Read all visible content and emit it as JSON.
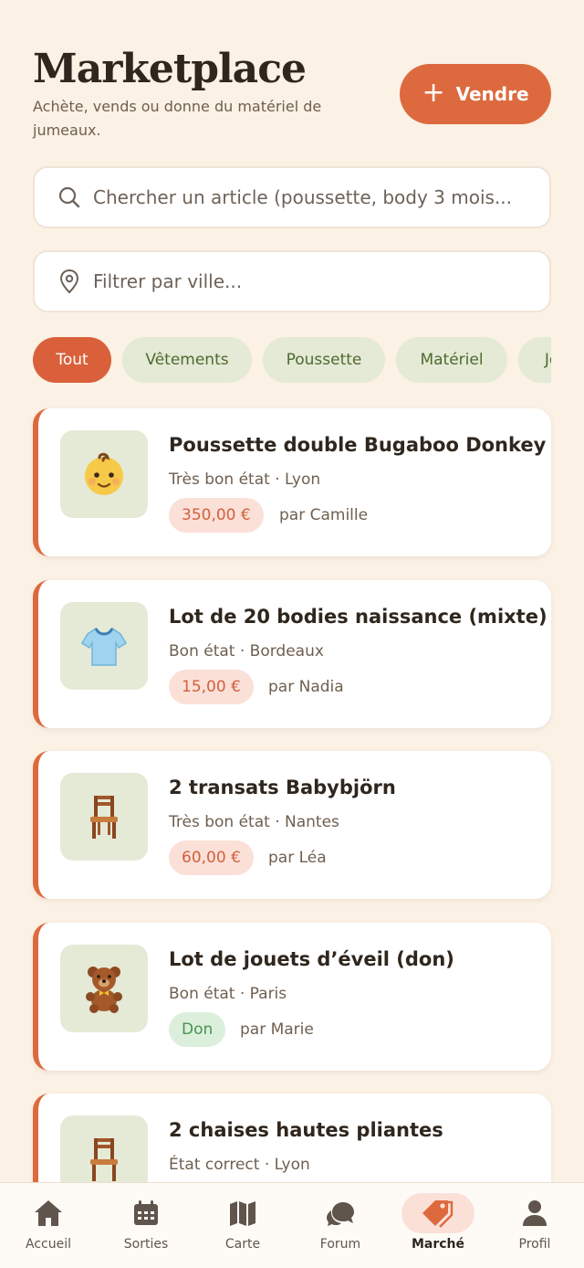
{
  "header": {
    "title": "Marketplace",
    "subtitle": "Achète, vends ou donne du matériel de jumeaux.",
    "sell_label": "Vendre"
  },
  "search": {
    "placeholder": "Chercher un article (poussette, body 3 mois..."
  },
  "city_filter": {
    "placeholder": "Filtrer par ville..."
  },
  "categories": [
    "Tout",
    "Vêtements",
    "Poussette",
    "Matériel",
    "Jouets"
  ],
  "listings": [
    {
      "title": "Poussette double Bugaboo Donkey",
      "meta": "Très bon état · Lyon",
      "price": "350,00 €",
      "seller": "par Camille",
      "icon": "baby-face"
    },
    {
      "title": "Lot de 20 bodies naissance (mixte)",
      "meta": "Bon état · Bordeaux",
      "price": "15,00 €",
      "seller": "par Nadia",
      "icon": "t-shirt"
    },
    {
      "title": "2 transats Babybjörn",
      "meta": "Très bon état · Nantes",
      "price": "60,00 €",
      "seller": "par Léa",
      "icon": "chair"
    },
    {
      "title": "Lot de jouets d’éveil (don)",
      "meta": "Bon état · Paris",
      "price": "Don",
      "seller": "par Marie",
      "icon": "teddy-bear"
    },
    {
      "title": "2 chaises hautes pliantes",
      "meta": "État correct · Lyon",
      "icon": "chair"
    }
  ],
  "tabs": [
    "Accueil",
    "Sorties",
    "Carte",
    "Forum",
    "Marché",
    "Profil"
  ],
  "colors": {
    "accent": "#dd6a3e",
    "background": "#fbf1e5",
    "chip": "#e4ead6",
    "don": "#4b9253"
  }
}
